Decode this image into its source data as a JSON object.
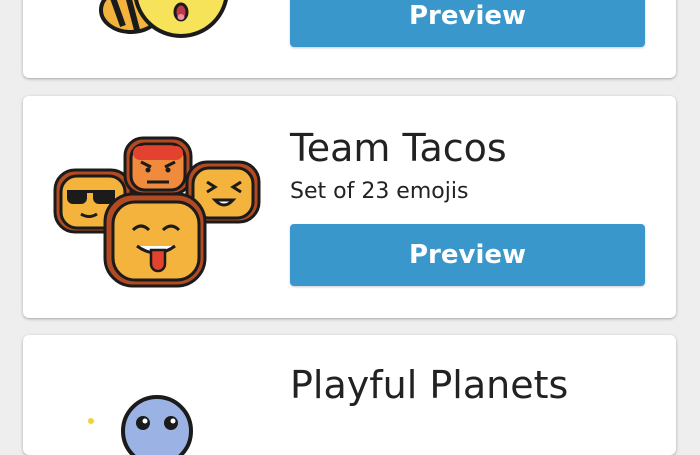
{
  "colors": {
    "preview_button": "#3a97cb",
    "page_background": "#eeeeee",
    "card_background": "#ffffff",
    "text": "#222222"
  },
  "packs": [
    {
      "title": "",
      "subtitle": "",
      "button_label": "Preview",
      "icon": "bee-emoji-icon"
    },
    {
      "title": "Team Tacos",
      "subtitle": "Set of 23 emojis",
      "button_label": "Preview",
      "icon": "taco-emojis-icon"
    },
    {
      "title": "Playful Planets",
      "subtitle": "",
      "button_label": "",
      "icon": "planet-emoji-icon"
    }
  ]
}
